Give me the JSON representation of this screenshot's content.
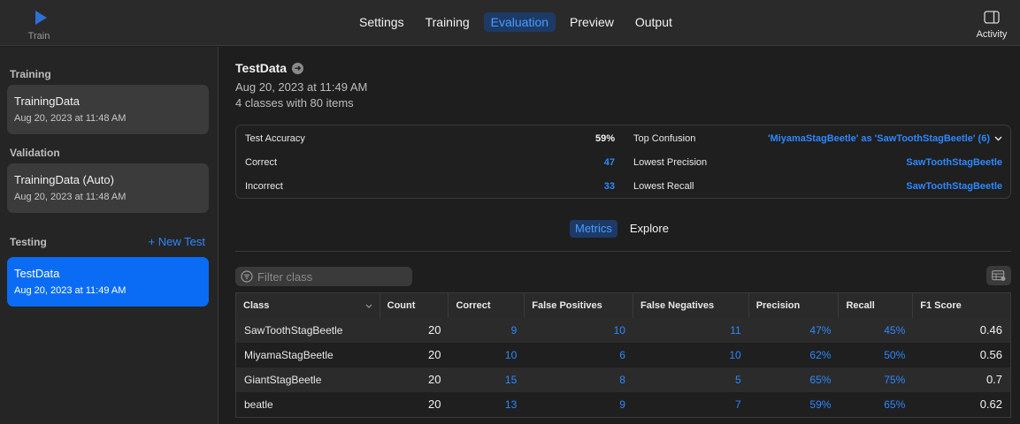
{
  "toolbar": {
    "train_label": "Train",
    "tabs": [
      "Settings",
      "Training",
      "Evaluation",
      "Preview",
      "Output"
    ],
    "activity_label": "Activity"
  },
  "sidebar": {
    "training_title": "Training",
    "training_item": {
      "title": "TrainingData",
      "date": "Aug 20, 2023 at 11:48 AM"
    },
    "validation_title": "Validation",
    "validation_item": {
      "title": "TrainingData (Auto)",
      "date": "Aug 20, 2023 at 11:48 AM"
    },
    "testing_title": "Testing",
    "new_test_label": "+ New Test",
    "testing_item": {
      "title": "TestData",
      "date": "Aug 20, 2023 at 11:49 AM"
    }
  },
  "header": {
    "title": "TestData",
    "date": "Aug 20, 2023 at 11:49 AM",
    "summary": "4 classes with 80 items"
  },
  "summary": {
    "test_accuracy_label": "Test Accuracy",
    "test_accuracy": "59%",
    "correct_label": "Correct",
    "correct": "47",
    "incorrect_label": "Incorrect",
    "incorrect": "33",
    "top_confusion_label": "Top Confusion",
    "top_confusion": "'MiyamaStagBeetle' as 'SawToothStagBeetle' (6)",
    "lowest_precision_label": "Lowest Precision",
    "lowest_precision": "SawToothStagBeetle",
    "lowest_recall_label": "Lowest Recall",
    "lowest_recall": "SawToothStagBeetle"
  },
  "segments": {
    "metrics": "Metrics",
    "explore": "Explore"
  },
  "filter": {
    "placeholder": "Filter class"
  },
  "table": {
    "headers": [
      "Class",
      "Count",
      "Correct",
      "False Positives",
      "False Negatives",
      "Precision",
      "Recall",
      "F1 Score"
    ],
    "rows": [
      [
        "SawToothStagBeetle",
        "20",
        "9",
        "10",
        "11",
        "47%",
        "45%",
        "0.46"
      ],
      [
        "MiyamaStagBeetle",
        "20",
        "10",
        "6",
        "10",
        "62%",
        "50%",
        "0.56"
      ],
      [
        "GiantStagBeetle",
        "20",
        "15",
        "8",
        "5",
        "65%",
        "75%",
        "0.7"
      ],
      [
        "beatle",
        "20",
        "13",
        "9",
        "7",
        "59%",
        "65%",
        "0.62"
      ]
    ]
  },
  "colors": {
    "accent": "#2d88ff",
    "selected": "#0a6cf5",
    "background": "#1e1e1e"
  }
}
